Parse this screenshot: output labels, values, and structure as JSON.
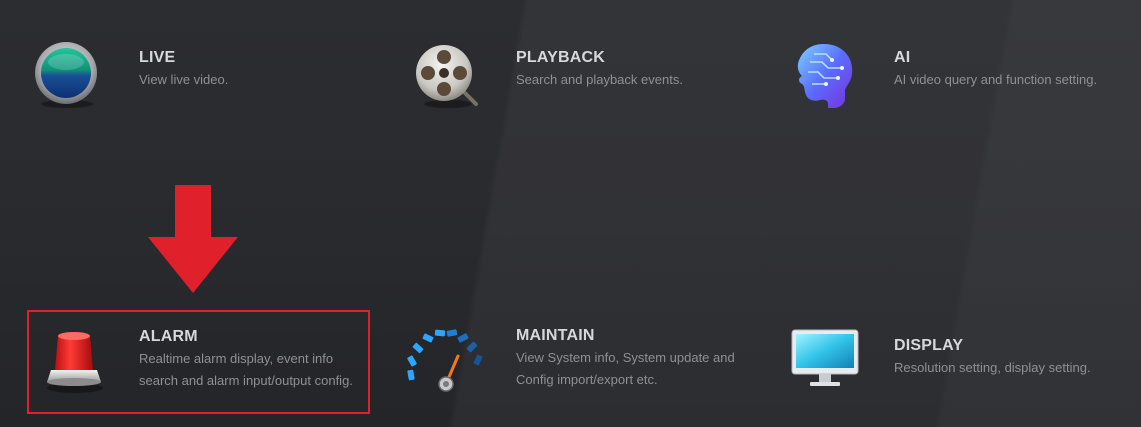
{
  "menu": {
    "live": {
      "title": "LIVE",
      "desc": [
        "View live video."
      ],
      "icon": "live-lens-icon"
    },
    "playback": {
      "title": "PLAYBACK",
      "desc": [
        "Search and playback events."
      ],
      "icon": "film-reel-icon"
    },
    "ai": {
      "title": "AI",
      "desc": [
        "AI video query and function setting."
      ],
      "icon": "ai-head-icon"
    },
    "alarm": {
      "title": "ALARM",
      "desc": [
        "Realtime alarm display, event info",
        "search and alarm input/output config."
      ],
      "icon": "alarm-siren-icon"
    },
    "maintain": {
      "title": "MAINTAIN",
      "desc": [
        "View System info, System update and",
        "Config import/export etc."
      ],
      "icon": "gauge-icon"
    },
    "display": {
      "title": "DISPLAY",
      "desc": [
        "Resolution setting, display setting."
      ],
      "icon": "monitor-icon"
    }
  },
  "annotation": {
    "arrow_color": "#e0202a",
    "highlight_color": "#e0202a"
  }
}
